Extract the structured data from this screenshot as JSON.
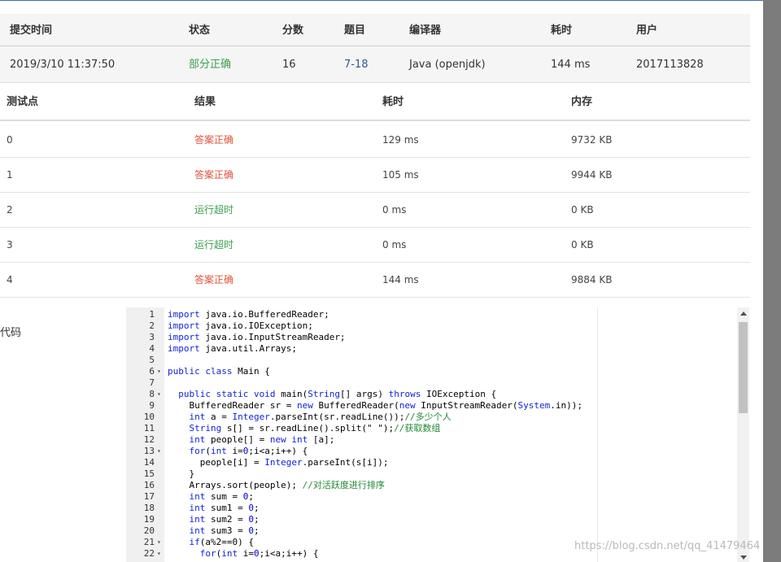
{
  "submission": {
    "headers": [
      "提交时间",
      "状态",
      "分数",
      "题目",
      "编译器",
      "耗时",
      "用户"
    ],
    "row": {
      "time": "2019/3/10 11:37:50",
      "status": "部分正确",
      "score": "16",
      "problem": "7-18",
      "compiler": "Java (openjdk)",
      "duration": "144 ms",
      "user": "2017113828"
    }
  },
  "testpoints": {
    "headers": [
      "测试点",
      "结果",
      "耗时",
      "内存"
    ],
    "rows": [
      {
        "id": "0",
        "result": "答案正确",
        "status": "accepted",
        "time": "129 ms",
        "memory": "9732 KB"
      },
      {
        "id": "1",
        "result": "答案正确",
        "status": "accepted",
        "time": "105 ms",
        "memory": "9944 KB"
      },
      {
        "id": "2",
        "result": "运行超时",
        "status": "timeout",
        "time": "0 ms",
        "memory": "0 KB"
      },
      {
        "id": "3",
        "result": "运行超时",
        "status": "timeout",
        "time": "0 ms",
        "memory": "0 KB"
      },
      {
        "id": "4",
        "result": "答案正确",
        "status": "accepted",
        "time": "144 ms",
        "memory": "9884 KB"
      }
    ]
  },
  "code_label": "代码",
  "code_lines": [
    {
      "n": "1",
      "fold": "",
      "text": "import java.io.BufferedReader;"
    },
    {
      "n": "2",
      "fold": "",
      "text": "import java.io.IOException;"
    },
    {
      "n": "3",
      "fold": "",
      "text": "import java.io.InputStreamReader;"
    },
    {
      "n": "4",
      "fold": "",
      "text": "import java.util.Arrays;"
    },
    {
      "n": "5",
      "fold": "",
      "text": ""
    },
    {
      "n": "6",
      "fold": "▾",
      "text": "public class Main {"
    },
    {
      "n": "7",
      "fold": "",
      "text": ""
    },
    {
      "n": "8",
      "fold": "▾",
      "text": "  public static void main(String[] args) throws IOException {"
    },
    {
      "n": "9",
      "fold": "",
      "text": "    BufferedReader sr = new BufferedReader(new InputStreamReader(System.in));"
    },
    {
      "n": "10",
      "fold": "",
      "text": "    int a = Integer.parseInt(sr.readLine());//多少个人"
    },
    {
      "n": "11",
      "fold": "",
      "text": "    String s[] = sr.readLine().split(\" \");//获取数组"
    },
    {
      "n": "12",
      "fold": "",
      "text": "    int people[] = new int [a];"
    },
    {
      "n": "13",
      "fold": "▾",
      "text": "    for(int i=0;i<a;i++) {"
    },
    {
      "n": "14",
      "fold": "",
      "text": "      people[i] = Integer.parseInt(s[i]);"
    },
    {
      "n": "15",
      "fold": "",
      "text": "    }"
    },
    {
      "n": "16",
      "fold": "",
      "text": "    Arrays.sort(people); //对活跃度进行排序"
    },
    {
      "n": "17",
      "fold": "",
      "text": "    int sum = 0;"
    },
    {
      "n": "18",
      "fold": "",
      "text": "    int sum1 = 0;"
    },
    {
      "n": "19",
      "fold": "",
      "text": "    int sum2 = 0;"
    },
    {
      "n": "20",
      "fold": "",
      "text": "    int sum3 = 0;"
    },
    {
      "n": "21",
      "fold": "▾",
      "text": "    if(a%2==0) {"
    },
    {
      "n": "22",
      "fold": "▾",
      "text": "      for(int i=0;i<a;i++) {"
    }
  ],
  "watermark": "https://blog.csdn.net/qq_41479464",
  "colors": {
    "accepted": "#e0533d",
    "timeout": "#3aa04a",
    "partial": "#3aa04a",
    "link": "#2b5d94"
  }
}
